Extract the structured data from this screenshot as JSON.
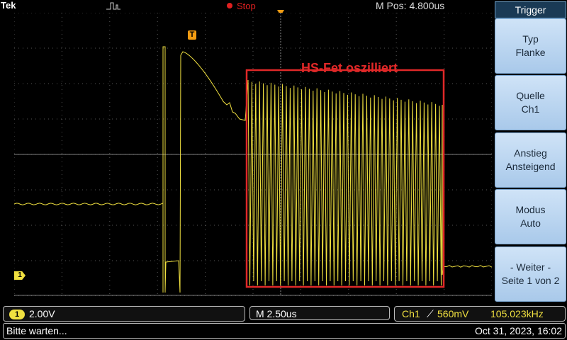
{
  "header": {
    "brand": "Tek",
    "run_state": "Stop",
    "m_pos": "M Pos: 4.800us"
  },
  "screen": {
    "annotation": "HS-Fet oszilliert",
    "trigger_marker": "T",
    "channel_marker": "1",
    "trace_color": "#f0e040",
    "annotation_color": "#e02828"
  },
  "trigger_menu": {
    "title": "Trigger",
    "items": [
      {
        "line1": "Typ",
        "line2": "Flanke"
      },
      {
        "line1": "Quelle",
        "line2": "Ch1"
      },
      {
        "line1": "Anstieg",
        "line2": "Ansteigend"
      },
      {
        "line1": "Modus",
        "line2": "Auto"
      },
      {
        "line1": "- Weiter -",
        "line2": "Seite 1 von 2"
      }
    ]
  },
  "status": {
    "ch_badge": "1",
    "volts_div": "2.00V",
    "time_div": "M 2.50us",
    "trig_source": "Ch1",
    "trig_level": "560mV",
    "frequency": "105.023kHz",
    "message": "Bitte warten...",
    "datetime": "Oct 31, 2023, 16:02"
  }
}
